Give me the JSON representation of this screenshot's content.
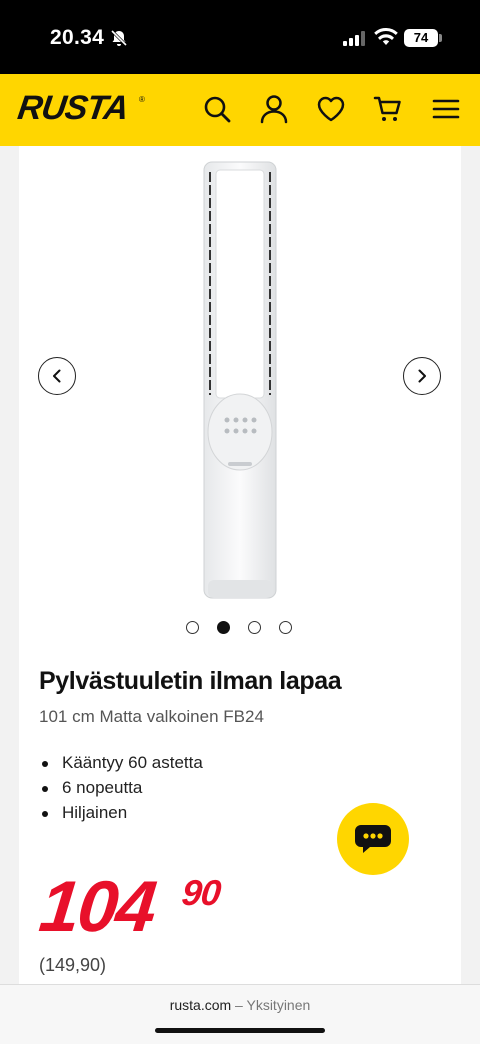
{
  "status": {
    "time": "20.34",
    "battery": "74"
  },
  "header": {
    "logo": "RUSTA",
    "icons": [
      "search-icon",
      "account-icon",
      "wishlist-heart-icon",
      "cart-icon",
      "menu-icon"
    ],
    "brand_color": "#ffd600"
  },
  "gallery": {
    "total_images": 4,
    "active_index": 1
  },
  "product": {
    "title": "Pylvästuuletin ilman lapaa",
    "subtitle": "101 cm Matta valkoinen FB24",
    "features": [
      "Kääntyy 60 astetta",
      "6 nopeutta",
      "Hiljainen"
    ],
    "price_main": "104",
    "price_cents": "90",
    "old_price": "(149,90)",
    "price_color": "#e8102a"
  },
  "browser": {
    "domain": "rusta.com",
    "separator": " – ",
    "mode": "Yksityinen"
  }
}
